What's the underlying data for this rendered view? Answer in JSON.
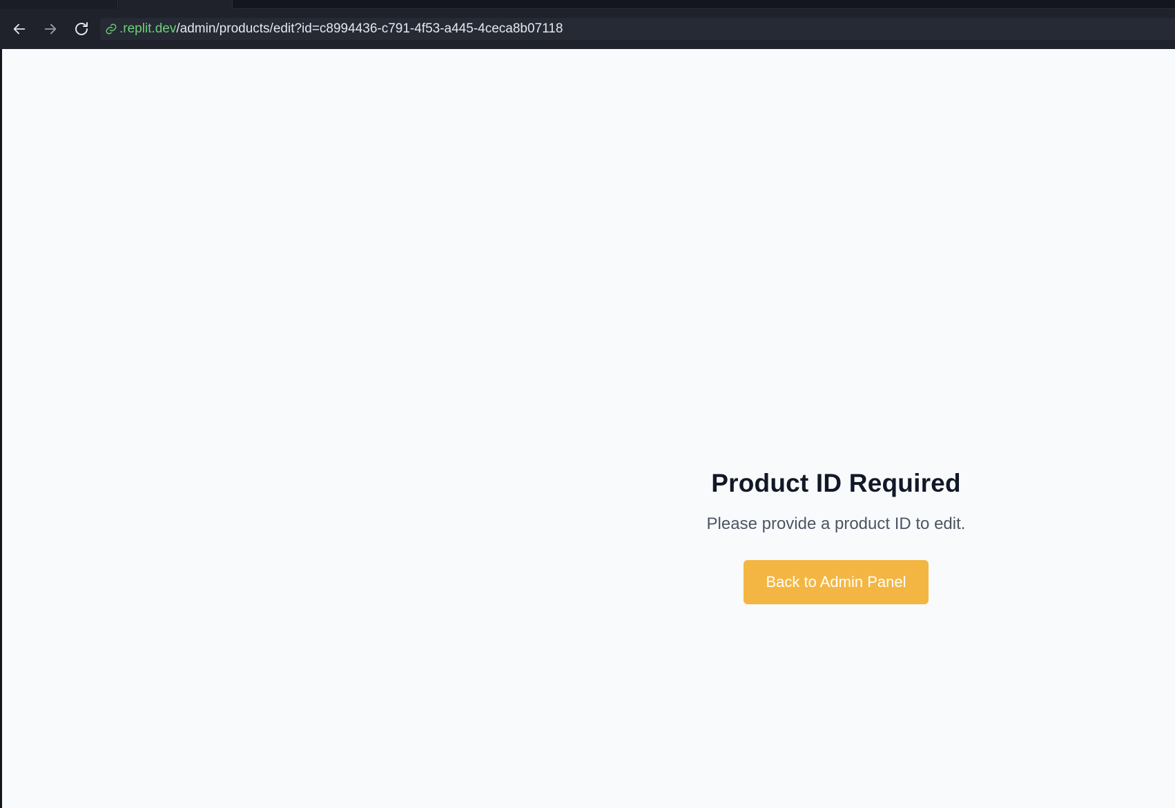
{
  "browser": {
    "url_domain": ".replit.dev",
    "url_path": "/admin/products/edit?id=c8994436-c791-4f53-a445-4ceca8b07118",
    "icons": {
      "back": "arrow-left-icon",
      "forward": "arrow-right-icon",
      "reload": "reload-icon",
      "link": "link-icon"
    },
    "colors": {
      "chrome_bg": "#1f222b",
      "url_domain": "#6fd07a",
      "url_text": "#e6e8ee"
    }
  },
  "page": {
    "title": "Product ID Required",
    "message": "Please provide a product ID to edit.",
    "back_button_label": "Back to Admin Panel",
    "colors": {
      "background": "#f8fafc",
      "title": "#111827",
      "message": "#4b5563",
      "button_bg": "#f4b642",
      "button_text": "#ffffff"
    }
  }
}
